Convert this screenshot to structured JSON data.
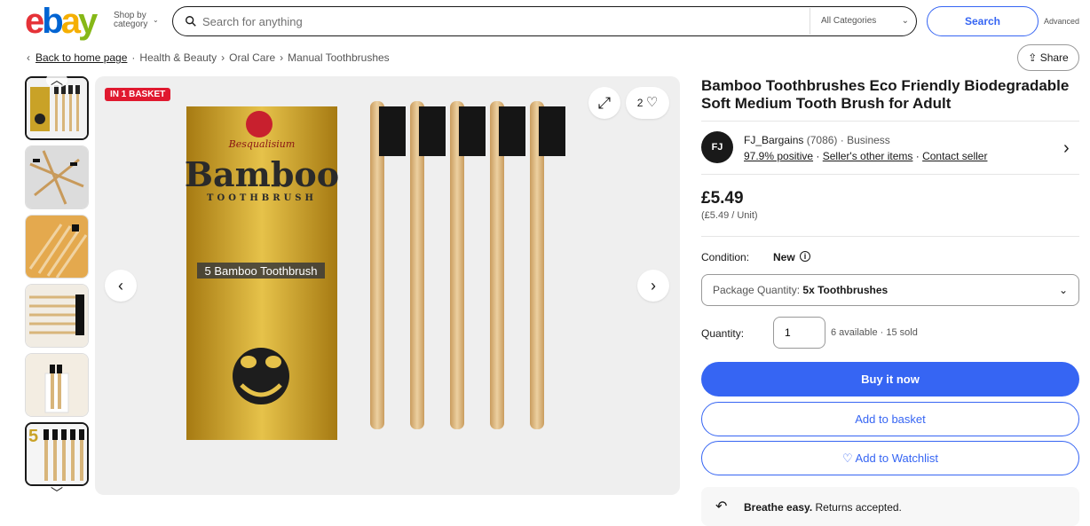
{
  "header": {
    "logo_letters": [
      "e",
      "b",
      "a",
      "y"
    ],
    "logo_colors": [
      "#e53238",
      "#0064d2",
      "#f5af02",
      "#86b817"
    ],
    "shop_by_category": "Shop by category",
    "search_placeholder": "Search for anything",
    "category_select": "All Categories",
    "search_button": "Search",
    "advanced_link": "Advanced"
  },
  "breadcrumb": {
    "back": "Back to home page",
    "items": [
      "Health & Beauty",
      "Oral Care",
      "Manual Toothbrushes"
    ],
    "share": "Share"
  },
  "gallery": {
    "badge": "IN 1 BASKET",
    "watch_count": "2",
    "box_brand": "Besqualisium",
    "box_title": "Bamboo",
    "box_subtitle": "TOOTHBRUSH",
    "box_label": "5 Bamboo Toothbrush",
    "thumb_count_label": "5"
  },
  "listing": {
    "title": "Bamboo Toothbrushes Eco Friendly Biodegradable Soft Medium Tooth Brush for Adult",
    "seller": {
      "logo_text": "FJ",
      "name": "FJ_Bargains",
      "feedback_count": "(7086)",
      "type": "Business",
      "positive": "97.9% positive",
      "other_items": "Seller's other items",
      "contact": "Contact seller"
    },
    "price": "£5.49",
    "unit_price": "(£5.49 / Unit)",
    "condition_label": "Condition:",
    "condition_value": "New",
    "package_label": "Package Quantity:",
    "package_value": "5x Toothbrushes",
    "quantity_label": "Quantity:",
    "quantity_value": "1",
    "availability": "6 available · 15 sold",
    "buy_now": "Buy it now",
    "add_to_basket": "Add to basket",
    "add_to_watchlist": "Add to Watchlist",
    "returns_bold": "Breathe easy.",
    "returns_text": "Returns accepted."
  }
}
